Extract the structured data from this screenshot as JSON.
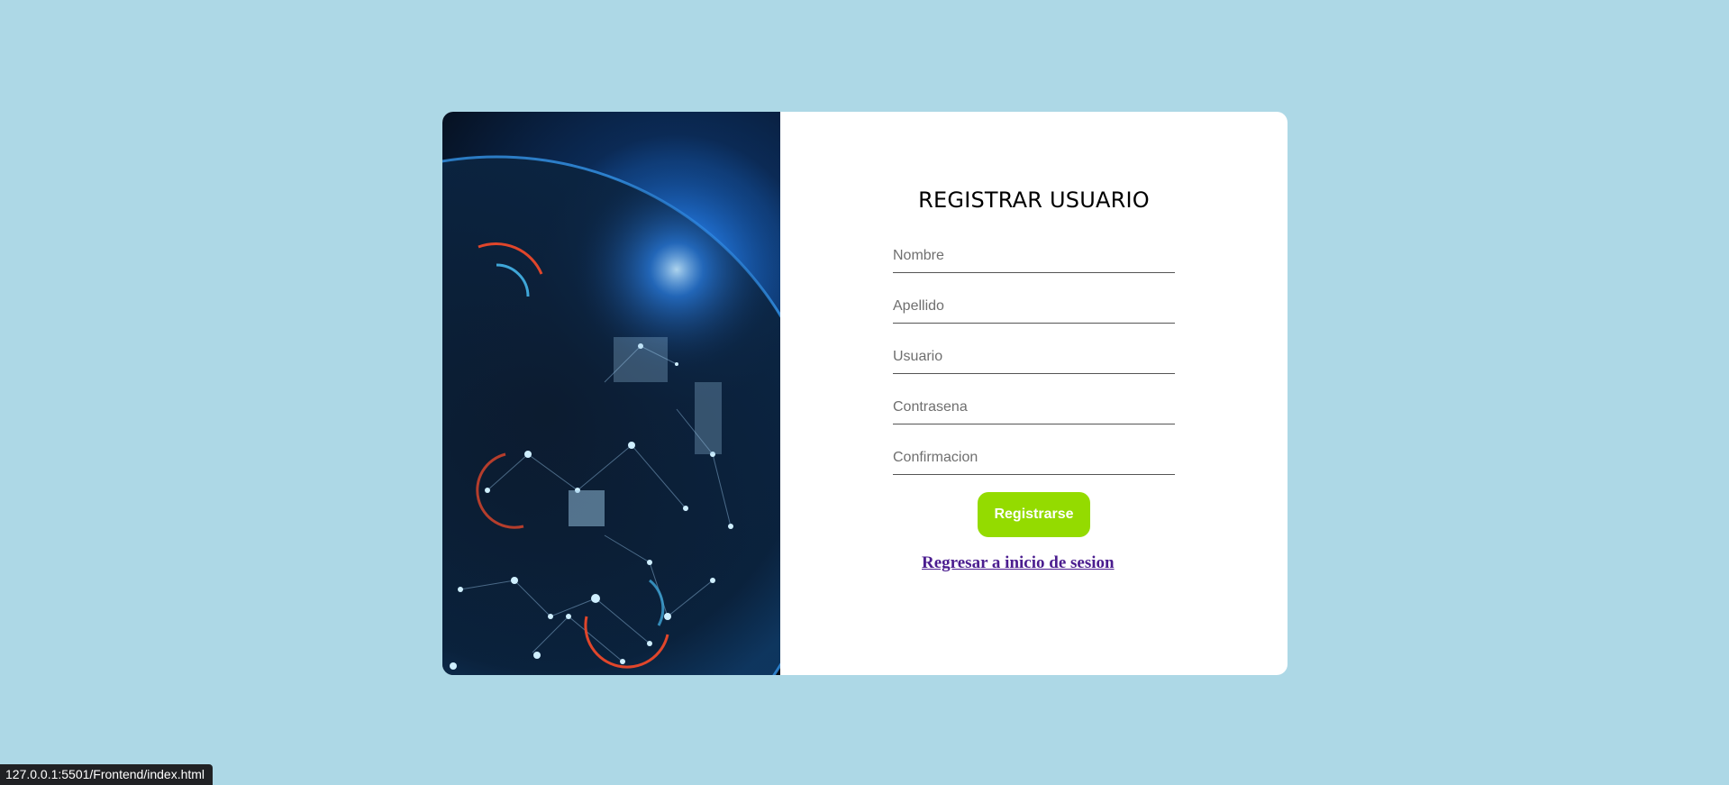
{
  "form": {
    "title": "REGISTRAR USUARIO",
    "fields": [
      {
        "placeholder": "Nombre"
      },
      {
        "placeholder": "Apellido"
      },
      {
        "placeholder": "Usuario"
      },
      {
        "placeholder": "Contrasena"
      },
      {
        "placeholder": "Confirmacion"
      }
    ],
    "submit_label": "Registrarse",
    "back_link": "Regresar a inicio de sesion"
  },
  "status_bar": {
    "url": "127.0.0.1:5501/Frontend/index.html"
  },
  "colors": {
    "background": "#add8e6",
    "button": "#94db00",
    "link": "#4b1d8f"
  }
}
